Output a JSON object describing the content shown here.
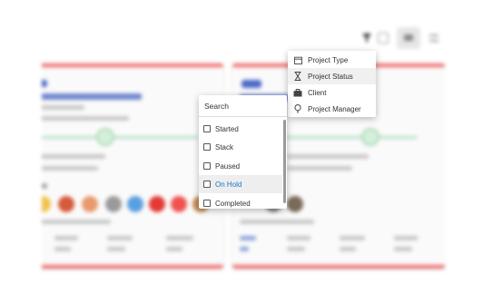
{
  "toolbar": {
    "filter_icon": "filter-icon",
    "view_toggle_icons": [
      "grid-view-icon",
      "list-view-icon",
      "collapse-icon"
    ]
  },
  "filter_type_menu": {
    "items": [
      {
        "label": "Project Type",
        "icon": "calendar-icon",
        "active": false
      },
      {
        "label": "Project Status",
        "icon": "hourglass-icon",
        "active": true
      },
      {
        "label": "Client",
        "icon": "briefcase-icon",
        "active": false
      },
      {
        "label": "Project Manager",
        "icon": "lightbulb-icon",
        "active": false
      }
    ]
  },
  "status_menu": {
    "search_label": "Search",
    "options": [
      {
        "label": "Started",
        "checked": false
      },
      {
        "label": "Stack",
        "checked": false
      },
      {
        "label": "Paused",
        "checked": false
      },
      {
        "label": "On Hold",
        "checked": false,
        "highlighted": true
      },
      {
        "label": "Completed",
        "checked": false
      }
    ]
  },
  "colors": {
    "card_accent": "#ef6b6b",
    "progress": "#b8dfc4",
    "highlight_text": "#1a73c8"
  }
}
